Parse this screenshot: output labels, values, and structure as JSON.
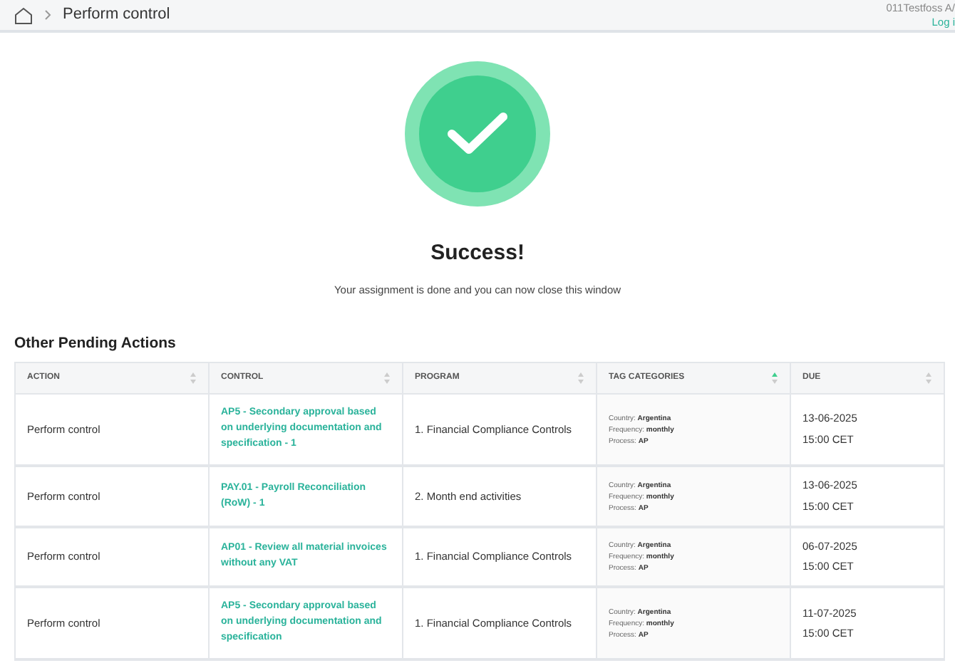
{
  "header": {
    "breadcrumb": "Perform control",
    "user": "011Testfoss A/",
    "login_link": "Log i"
  },
  "result": {
    "title": "Success!",
    "message": "Your assignment is done and you can now close this window"
  },
  "section_title": "Other Pending Actions",
  "table": {
    "columns": [
      {
        "label": "ACTION",
        "sorted": false
      },
      {
        "label": "CONTROL",
        "sorted": false
      },
      {
        "label": "PROGRAM",
        "sorted": false
      },
      {
        "label": "TAG CATEGORIES",
        "sorted": true
      },
      {
        "label": "DUE",
        "sorted": false
      }
    ],
    "rows": [
      {
        "action": "Perform control",
        "control": "AP5 - Secondary approval based on underlying documentation and specification - 1",
        "program": "1. Financial Compliance Controls",
        "tags": [
          {
            "key": "Country:",
            "value": "Argentina"
          },
          {
            "key": "Frequency:",
            "value": "monthly"
          },
          {
            "key": "Process:",
            "value": "AP"
          }
        ],
        "due_date": "13-06-2025",
        "due_time": "15:00 CET"
      },
      {
        "action": "Perform control",
        "control": "PAY.01 - Payroll Reconciliation (RoW) - 1",
        "program": "2. Month end activities",
        "tags": [
          {
            "key": "Country:",
            "value": "Argentina"
          },
          {
            "key": "Frequency:",
            "value": "monthly"
          },
          {
            "key": "Process:",
            "value": "AP"
          }
        ],
        "due_date": "13-06-2025",
        "due_time": "15:00 CET"
      },
      {
        "action": "Perform control",
        "control": "AP01 - Review all material invoices without any VAT",
        "program": "1. Financial Compliance Controls",
        "tags": [
          {
            "key": "Country:",
            "value": "Argentina"
          },
          {
            "key": "Frequency:",
            "value": "monthly"
          },
          {
            "key": "Process:",
            "value": "AP"
          }
        ],
        "due_date": "06-07-2025",
        "due_time": "15:00 CET"
      },
      {
        "action": "Perform control",
        "control": "AP5 - Secondary approval based on underlying documentation and specification",
        "program": "1. Financial Compliance Controls",
        "tags": [
          {
            "key": "Country:",
            "value": "Argentina"
          },
          {
            "key": "Frequency:",
            "value": "monthly"
          },
          {
            "key": "Process:",
            "value": "AP"
          }
        ],
        "due_date": "11-07-2025",
        "due_time": "15:00 CET"
      }
    ]
  }
}
